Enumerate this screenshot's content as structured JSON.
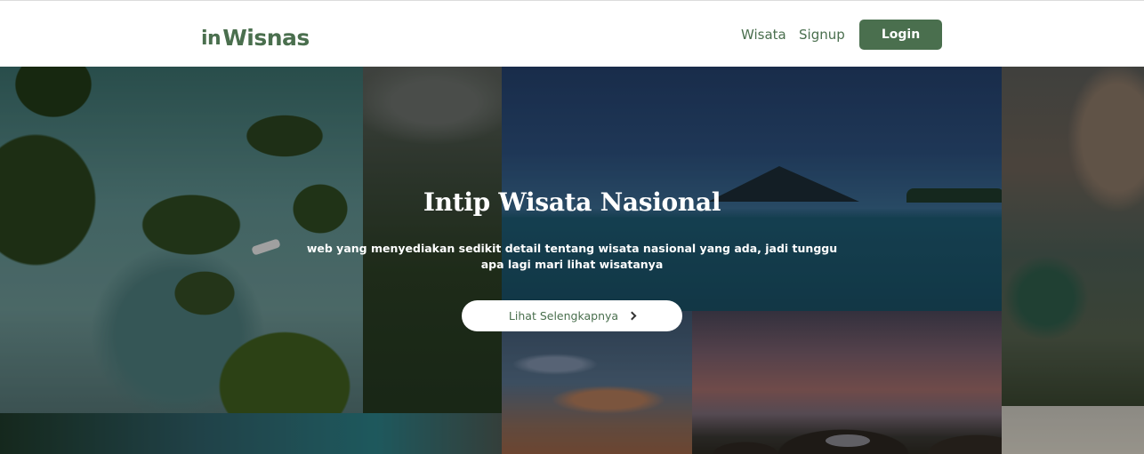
{
  "brand": {
    "logo_prefix": "in",
    "logo_name": "Wisnas",
    "color": "#4a6f4e"
  },
  "nav": {
    "links": [
      "Wisata",
      "Signup"
    ],
    "login_label": "Login"
  },
  "hero": {
    "title": "Intip Wisata Nasional",
    "description": "web yang menyediakan sedikit detail tentang wisata nasional yang ada, jadi tunggu apa lagi mari lihat wisatanya",
    "cta_label": "Lihat Selengkapnya",
    "cta_icon": "chevron-right-icon"
  }
}
